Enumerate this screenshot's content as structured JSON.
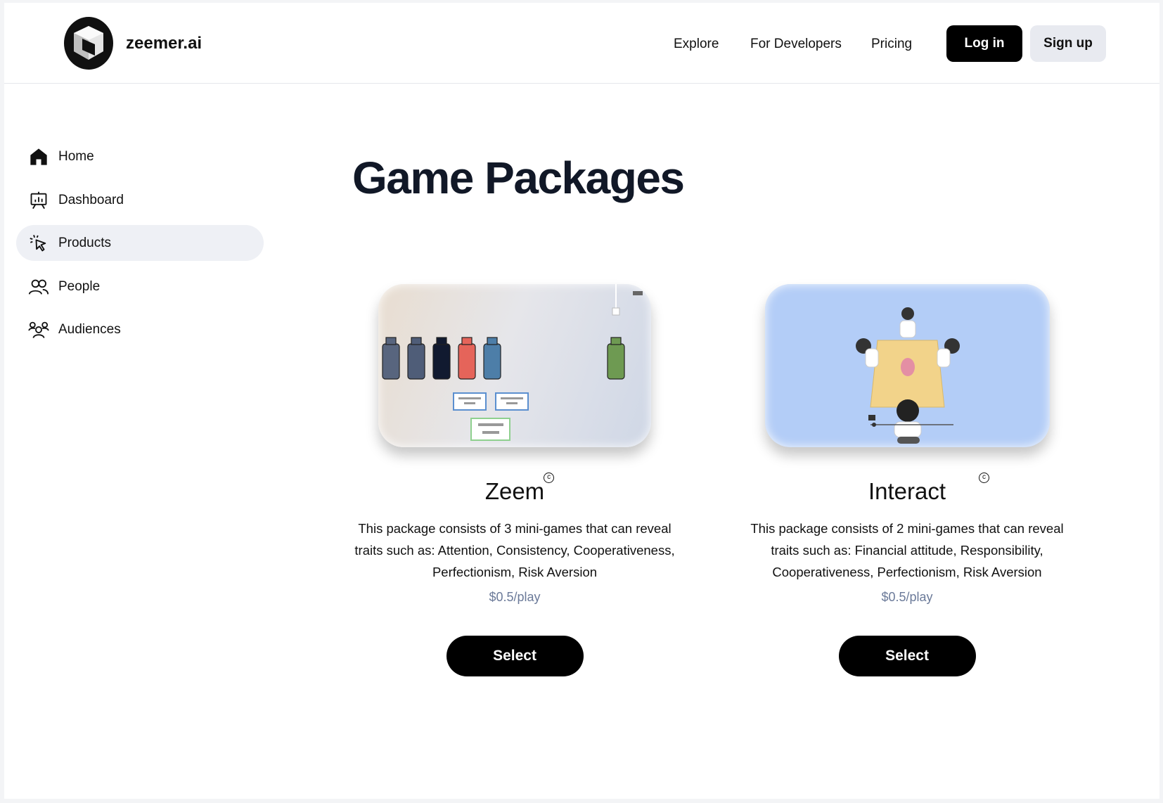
{
  "header": {
    "brand": "zeemer.ai",
    "nav": [
      "Explore",
      "For Developers",
      "Pricing"
    ],
    "login_label": "Log in",
    "signup_label": "Sign up"
  },
  "sidebar": {
    "items": [
      {
        "label": "Home",
        "icon": "home-icon"
      },
      {
        "label": "Dashboard",
        "icon": "presentation-icon"
      },
      {
        "label": "Products",
        "icon": "cursor-click-icon",
        "active": true
      },
      {
        "label": "People",
        "icon": "users-icon"
      },
      {
        "label": "Audiences",
        "icon": "user-group-icon"
      }
    ]
  },
  "main": {
    "title": "Game Packages",
    "packages": [
      {
        "name": "Zeem",
        "description": "This package consists of 3 mini-games that can reveal traits such as: Attention, Consistency, Cooperativeness, Perfectionism, Risk Aversion",
        "price": "$0.5/play",
        "select_label": "Select"
      },
      {
        "name": "Interact",
        "description": "This package consists of 2 mini-games that can reveal traits such as: Financial attitude, Responsibility, Cooperativeness, Perfectionism, Risk Aversion",
        "price": "$0.5/play",
        "select_label": "Select"
      }
    ]
  },
  "colors": {
    "button_bg": "#000000",
    "signup_bg": "#e8eaf0",
    "active_nav_bg": "#eef0f5",
    "price_text": "#6b7a99",
    "interact_bg": "#b3cdf7"
  }
}
